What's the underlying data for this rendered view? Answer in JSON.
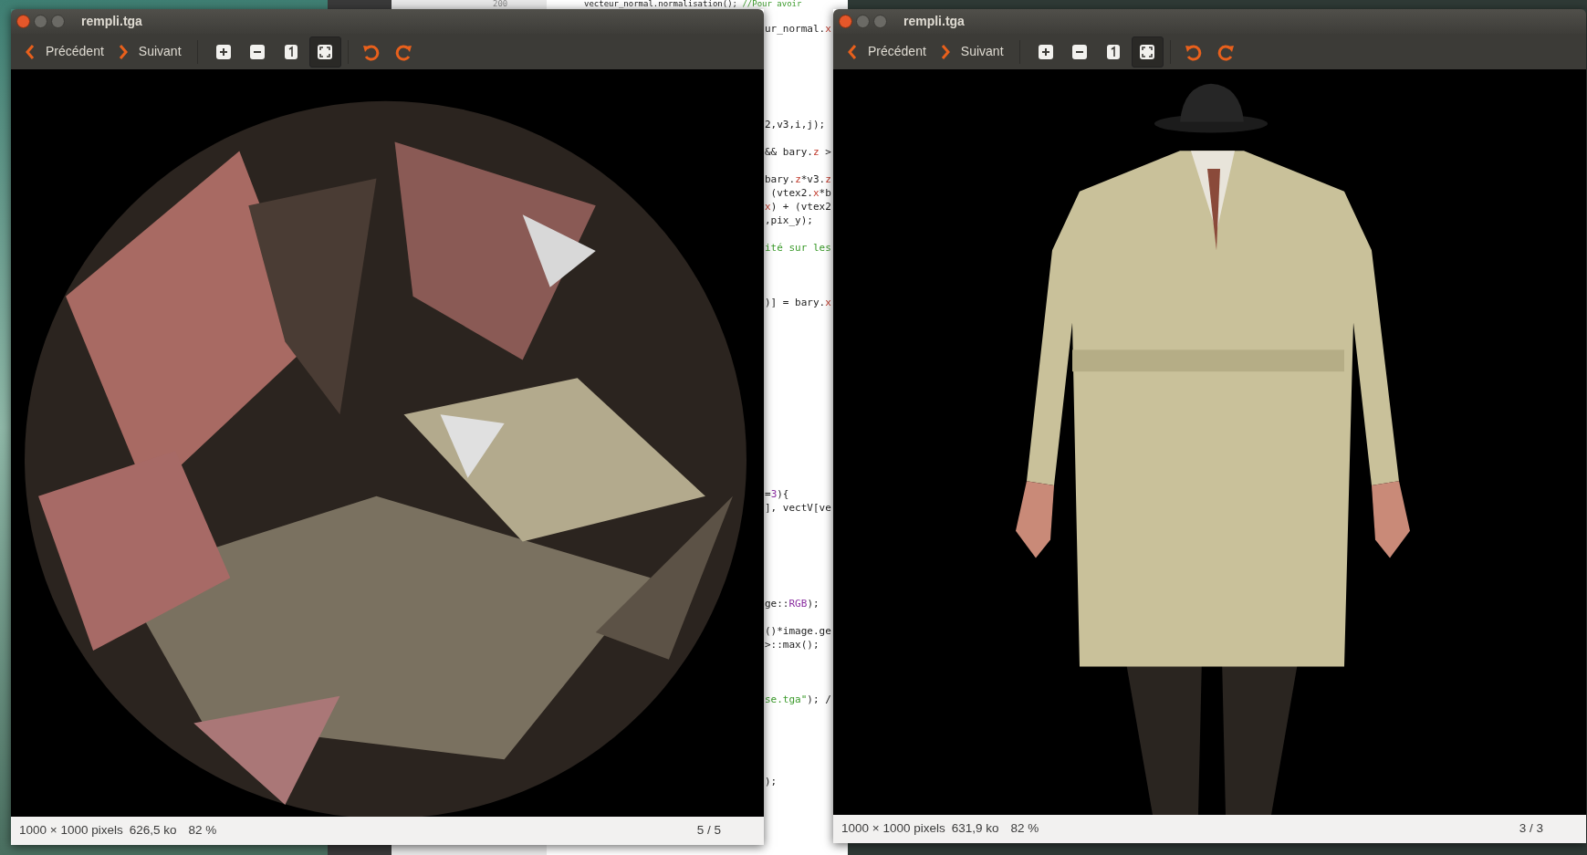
{
  "code_editor": {
    "line_number": "200",
    "top_line": [
      {
        "text": "vecteur_normal.normalisation(); ",
        "kind": "plain"
      },
      {
        "text": "//Pour avoir",
        "kind": "comment"
      }
    ],
    "lines": [
      {
        "kind": "blank"
      },
      {
        "kind": "blank"
      },
      {
        "kind": "code",
        "segments": [
          {
            "text": "ur_normal.",
            "kind": "plain"
          },
          {
            "text": "x",
            "kind": "field"
          }
        ]
      },
      {
        "kind": "blank"
      },
      {
        "kind": "blank"
      },
      {
        "kind": "blank"
      },
      {
        "kind": "blank"
      },
      {
        "kind": "blank"
      },
      {
        "kind": "blank"
      },
      {
        "kind": "code",
        "segments": [
          {
            "text": "2,v3,i,j);",
            "kind": "plain"
          }
        ]
      },
      {
        "kind": "blank"
      },
      {
        "kind": "code",
        "segments": [
          {
            "text": "&& bary.",
            "kind": "plain"
          },
          {
            "text": "z",
            "kind": "field"
          },
          {
            "text": " >",
            "kind": "plain"
          }
        ]
      },
      {
        "kind": "blank"
      },
      {
        "kind": "code",
        "segments": [
          {
            "text": "bary.",
            "kind": "plain"
          },
          {
            "text": "z",
            "kind": "field"
          },
          {
            "text": "*v3.",
            "kind": "plain"
          },
          {
            "text": "z",
            "kind": "field"
          }
        ]
      },
      {
        "kind": "code",
        "segments": [
          {
            "text": " (vtex2.",
            "kind": "plain"
          },
          {
            "text": "x",
            "kind": "field"
          },
          {
            "text": "*b",
            "kind": "plain"
          }
        ]
      },
      {
        "kind": "code",
        "segments": [
          {
            "text": "x",
            "kind": "field"
          },
          {
            "text": ") + (vtex2",
            "kind": "plain"
          }
        ]
      },
      {
        "kind": "code",
        "segments": [
          {
            "text": ",pix_y);",
            "kind": "plain"
          }
        ]
      },
      {
        "kind": "blank"
      },
      {
        "kind": "code",
        "segments": [
          {
            "text": "ité sur les",
            "kind": "comment"
          }
        ]
      },
      {
        "kind": "blank"
      },
      {
        "kind": "blank"
      },
      {
        "kind": "blank"
      },
      {
        "kind": "code",
        "segments": [
          {
            "text": ")] = bary.",
            "kind": "plain"
          },
          {
            "text": "x",
            "kind": "field"
          }
        ]
      },
      {
        "kind": "blank"
      },
      {
        "kind": "blank"
      },
      {
        "kind": "blank"
      },
      {
        "kind": "blank"
      },
      {
        "kind": "blank"
      },
      {
        "kind": "blank"
      },
      {
        "kind": "blank"
      },
      {
        "kind": "blank"
      },
      {
        "kind": "blank"
      },
      {
        "kind": "blank"
      },
      {
        "kind": "blank"
      },
      {
        "kind": "blank"
      },
      {
        "kind": "blank"
      },
      {
        "kind": "code",
        "segments": [
          {
            "text": "=",
            "kind": "plain"
          },
          {
            "text": "3",
            "kind": "number"
          },
          {
            "text": "){",
            "kind": "plain"
          }
        ]
      },
      {
        "kind": "code",
        "segments": [
          {
            "text": "], vectV[ve",
            "kind": "plain"
          }
        ]
      },
      {
        "kind": "blank"
      },
      {
        "kind": "blank"
      },
      {
        "kind": "blank"
      },
      {
        "kind": "blank"
      },
      {
        "kind": "blank"
      },
      {
        "kind": "blank"
      },
      {
        "kind": "code",
        "segments": [
          {
            "text": "ge::",
            "kind": "plain"
          },
          {
            "text": "RGB",
            "kind": "enum"
          },
          {
            "text": ");",
            "kind": "plain"
          }
        ]
      },
      {
        "kind": "blank"
      },
      {
        "kind": "code",
        "segments": [
          {
            "text": "()*image.ge",
            "kind": "plain"
          }
        ]
      },
      {
        "kind": "code",
        "segments": [
          {
            "text": ">::max();",
            "kind": "plain"
          }
        ]
      },
      {
        "kind": "blank"
      },
      {
        "kind": "blank"
      },
      {
        "kind": "blank"
      },
      {
        "kind": "code",
        "segments": [
          {
            "text": "se.tga\"",
            "kind": "string"
          },
          {
            "text": "); /",
            "kind": "plain"
          }
        ]
      },
      {
        "kind": "blank"
      },
      {
        "kind": "blank"
      },
      {
        "kind": "blank"
      },
      {
        "kind": "blank"
      },
      {
        "kind": "blank"
      },
      {
        "kind": "code",
        "segments": [
          {
            "text": ");",
            "kind": "plain"
          }
        ]
      }
    ]
  },
  "windows": [
    {
      "title": "rempli.tga",
      "nav": [
        {
          "kind": "previous",
          "label": "Précédent"
        },
        {
          "kind": "next",
          "label": "Suivant"
        }
      ],
      "tools": [
        {
          "kind": "zoom-in",
          "selected": false
        },
        {
          "kind": "zoom-out",
          "selected": false
        },
        {
          "kind": "normal-size",
          "selected": false
        },
        {
          "kind": "best-fit",
          "selected": true
        },
        {
          "kind": "separator"
        },
        {
          "kind": "rotate-left",
          "selected": false
        },
        {
          "kind": "rotate-right",
          "selected": false
        }
      ],
      "image": {
        "kind": "picture"
      },
      "status_bar": {
        "dimensions": "1000 × 1000 pixels",
        "file_size": "626,5 ko",
        "zoom": "82 %",
        "position": "5 / 5"
      }
    },
    {
      "title": "rempli.tga",
      "nav": [
        {
          "kind": "previous",
          "label": "Précédent"
        },
        {
          "kind": "next",
          "label": "Suivant"
        }
      ],
      "tools": [
        {
          "kind": "zoom-in",
          "selected": false
        },
        {
          "kind": "zoom-out",
          "selected": false
        },
        {
          "kind": "normal-size",
          "selected": false
        },
        {
          "kind": "best-fit",
          "selected": true
        },
        {
          "kind": "separator"
        },
        {
          "kind": "rotate-left",
          "selected": false
        },
        {
          "kind": "rotate-right",
          "selected": false
        }
      ],
      "image": {
        "kind": "picture"
      },
      "status_bar": {
        "dimensions": "1000 × 1000 pixels",
        "file_size": "631,9 ko",
        "zoom": "82 %",
        "position": "3 / 3"
      }
    }
  ]
}
